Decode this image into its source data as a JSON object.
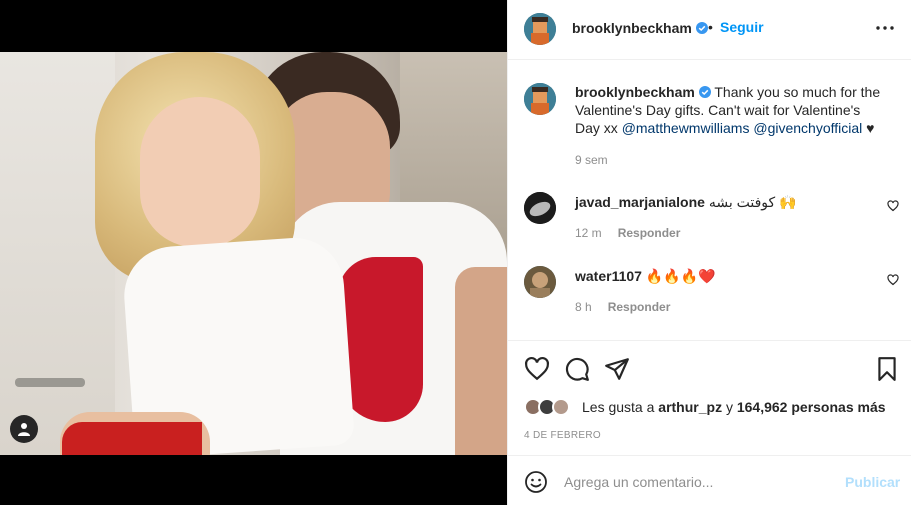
{
  "post": {
    "username": "brooklynbeckham",
    "follow_label": "Seguir",
    "separator": "•"
  },
  "caption": {
    "username": "brooklynbeckham",
    "text_1": "Thank you so much for the Valentine's Day gifts. Can't wait for Valentine's Day xx ",
    "mention_1": "@matthewmwilliams",
    "mention_2": "@givenchyofficial",
    "text_end": " ♥",
    "time": "9 sem"
  },
  "comments": [
    {
      "username": "javad_marjanialone",
      "text": "کوفتت بشه 🙌",
      "time": "12 m",
      "reply_label": "Responder"
    },
    {
      "username": "water1107",
      "text": "🔥🔥🔥❤️",
      "time": "8 h",
      "reply_label": "Responder"
    }
  ],
  "likes": {
    "prefix": "Les gusta a ",
    "user": "arthur_pz",
    "middle": " y ",
    "count": "164,962 personas más"
  },
  "date": "4 DE FEBRERO",
  "composer": {
    "placeholder": "Agrega un comentario...",
    "publish_label": "Publicar"
  },
  "icons": [
    "user-tag-icon",
    "verified-icon",
    "more-icon",
    "heart-icon",
    "comment-icon",
    "share-icon",
    "save-icon",
    "emoji-icon"
  ],
  "colors": {
    "accent": "#0095f6",
    "publish_disabled": "#b2dffc",
    "verified": "#3897f0",
    "muted": "#8e8e8e"
  }
}
